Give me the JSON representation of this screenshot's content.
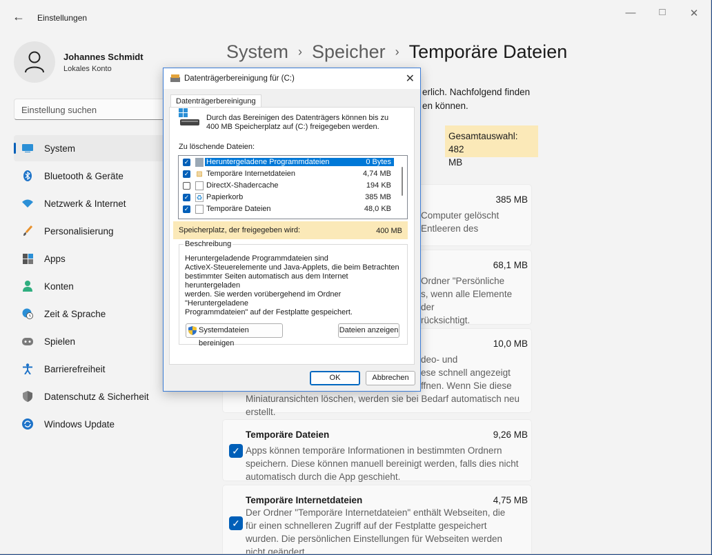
{
  "window": {
    "title": "Einstellungen",
    "back_icon": "back-arrow-icon",
    "controls": [
      "minimize-icon",
      "maximize-icon",
      "close-icon"
    ]
  },
  "user": {
    "name": "Johannes Schmidt",
    "account": "Lokales Konto"
  },
  "search": {
    "placeholder": "Einstellung suchen"
  },
  "nav": [
    {
      "label": "System",
      "icon": "monitor-icon",
      "active": true
    },
    {
      "label": "Bluetooth & Geräte",
      "icon": "bluetooth-icon"
    },
    {
      "label": "Netzwerk & Internet",
      "icon": "wifi-icon"
    },
    {
      "label": "Personalisierung",
      "icon": "brush-icon"
    },
    {
      "label": "Apps",
      "icon": "apps-icon"
    },
    {
      "label": "Konten",
      "icon": "person-icon"
    },
    {
      "label": "Zeit & Sprache",
      "icon": "globe-clock-icon"
    },
    {
      "label": "Spielen",
      "icon": "gamepad-icon"
    },
    {
      "label": "Barrierefreiheit",
      "icon": "accessibility-icon"
    },
    {
      "label": "Datenschutz & Sicherheit",
      "icon": "shield-icon"
    },
    {
      "label": "Windows Update",
      "icon": "sync-icon"
    }
  ],
  "breadcrumb": {
    "items": [
      "System",
      "Speicher",
      "Temporäre Dateien"
    ],
    "separator": "›"
  },
  "intro": {
    "line1": "erlich. Nachfolgend finden",
    "line2": "en können."
  },
  "total": {
    "line1": "Gesamtauswahl: 482",
    "line2": "MB"
  },
  "cards": [
    {
      "size": "385 MB",
      "desc": [
        "Computer gelöscht",
        "Entleeren des"
      ],
      "checked": true
    },
    {
      "size": "68,1 MB",
      "desc": [
        "Ordner \"Persönliche",
        "s, wenn alle Elemente",
        "der",
        "rücksichtigt."
      ],
      "checked": true
    },
    {
      "size": "10,0 MB",
      "desc": [
        "deo- und",
        "ese schnell angezeigt",
        "ffnen. Wenn Sie diese",
        "Miniaturansichten löschen, werden sie bei Bedarf automatisch neu",
        "erstellt."
      ],
      "checked": false
    },
    {
      "title": "Temporäre Dateien",
      "size": "9,26 MB",
      "desc": [
        "Apps können temporäre Informationen in bestimmten Ordnern",
        "speichern. Diese können manuell bereinigt werden, falls dies nicht",
        "automatisch durch die App geschieht."
      ],
      "checked": true
    },
    {
      "title": "Temporäre Internetdateien",
      "size": "4,75 MB",
      "desc": [
        "Der Ordner \"Temporäre Internetdateien\" enthält Webseiten, die",
        "für einen schnelleren Zugriff auf der Festplatte gespeichert",
        "wurden. Die persönlichen Einstellungen für Webseiten werden",
        "nicht geändert."
      ],
      "checked": true
    }
  ],
  "dialog": {
    "title": "Datenträgerbereinigung für  (C:)",
    "tab": "Datenträgerbereinigung",
    "info_line1": "Durch das Bereinigen des Datenträgers können bis zu",
    "info_line2": "400 MB Speicherplatz auf  (C:) freigegeben werden.",
    "list_label": "Zu löschende Dateien:",
    "files": [
      {
        "name": "Heruntergeladene Programmdateien",
        "size": "0 Bytes",
        "checked": true,
        "selected": true,
        "icon": "folder-icon"
      },
      {
        "name": "Temporäre Internetdateien",
        "size": "4,74 MB",
        "checked": true,
        "icon": "lock-icon"
      },
      {
        "name": "DirectX-Shadercache",
        "size": "194 KB",
        "checked": false,
        "icon": "document-icon"
      },
      {
        "name": "Papierkorb",
        "size": "385 MB",
        "checked": true,
        "icon": "recycle-bin-icon"
      },
      {
        "name": "Temporäre Dateien",
        "size": "48,0 KB",
        "checked": true,
        "icon": "document-icon"
      }
    ],
    "free_label": "Speicherplatz, der freigegeben wird:",
    "free_value": "400 MB",
    "desc_title": "Beschreibung",
    "desc_lines": [
      "Heruntergeladende Programmdateien sind",
      "ActiveX-Steuerelemente und Java-Applets, die beim Betrachten",
      "bestimmter Seiten automatisch aus dem Internet heruntergeladen",
      "werden. Sie werden vorübergehend im Ordner \"Heruntergeladene",
      "Programmdateien\" auf der Festplatte gespeichert."
    ],
    "btn_system": "Systemdateien bereinigen",
    "btn_show": "Dateien anzeigen",
    "btn_ok": "OK",
    "btn_cancel": "Abbrechen"
  }
}
